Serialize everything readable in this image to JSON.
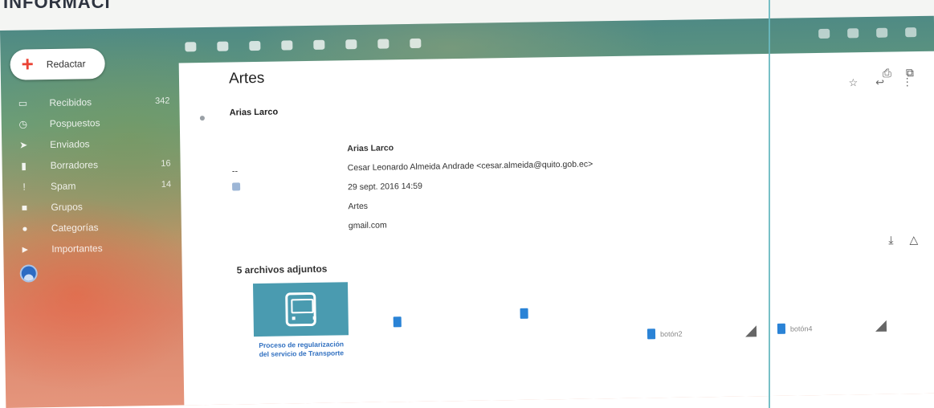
{
  "colors": {
    "compose_plus": "#ea4335",
    "attachment_thumb": "#4a9bb0",
    "file_icon": "#2a83d6"
  },
  "compose": {
    "label": "Redactar",
    "icon": "plus-icon"
  },
  "sidebar": {
    "items": [
      {
        "label": "Recibidos",
        "count": "342",
        "icon": "inbox-icon"
      },
      {
        "label": "Pospuestos",
        "count": "",
        "icon": "clock-icon"
      },
      {
        "label": "Enviados",
        "count": "",
        "icon": "send-icon"
      },
      {
        "label": "Borradores",
        "count": "16",
        "icon": "draft-icon"
      },
      {
        "label": "Spam",
        "count": "14",
        "icon": "spam-icon"
      },
      {
        "label": "Grupos",
        "count": "",
        "icon": "label-icon"
      },
      {
        "label": "Categorías",
        "count": "",
        "icon": "category-icon"
      },
      {
        "label": "Importantes",
        "count": "",
        "icon": "important-icon"
      }
    ]
  },
  "email": {
    "subject": "Artes",
    "sender_name": "Arias Larco",
    "forwarded": {
      "from_name": "Arias Larco",
      "to": "Cesar Leonardo Almeida Andrade <cesar.almeida@quito.gob.ec>",
      "date": "29 sept. 2016 14:59",
      "subject": "Artes",
      "domain": "gmail.com"
    },
    "dash": "--"
  },
  "attachments": {
    "title": "5 archivos adjuntos",
    "first_caption": "Proceso de regularización del servicio de Transporte",
    "file3": "botón2",
    "file4": "botón4"
  }
}
